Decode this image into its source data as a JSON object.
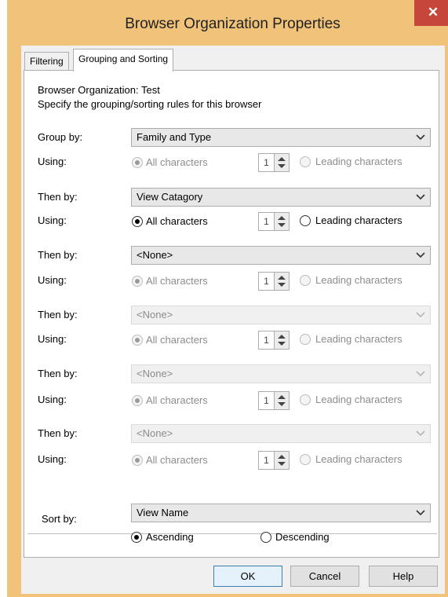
{
  "dialog": {
    "title": "Browser Organization Properties",
    "close_glyph": "✕"
  },
  "tabs": [
    {
      "label": "Filtering",
      "active": false
    },
    {
      "label": "Grouping and Sorting",
      "active": true
    }
  ],
  "header": {
    "org_line": "Browser Organization: Test",
    "desc_line": "Specify the grouping/sorting rules for this browser"
  },
  "labels": {
    "group_by": "Group by:",
    "then_by": "Then by:",
    "using": "Using:",
    "sort_by": "Sort by:",
    "all_chars": "All characters",
    "leading_chars": "Leading characters"
  },
  "rules": [
    {
      "value": "Family and Type",
      "enabled": true,
      "using_enabled": false,
      "count": "1"
    },
    {
      "value": "View Catagory",
      "enabled": true,
      "using_enabled": true,
      "count": "1"
    },
    {
      "value": "<None>",
      "enabled": true,
      "using_enabled": false,
      "count": "1"
    },
    {
      "value": "<None>",
      "enabled": false,
      "using_enabled": false,
      "count": "1"
    },
    {
      "value": "<None>",
      "enabled": false,
      "using_enabled": false,
      "count": "1"
    },
    {
      "value": "<None>",
      "enabled": false,
      "using_enabled": false,
      "count": "1"
    }
  ],
  "sort": {
    "value": "View Name",
    "ascending_label": "Ascending",
    "descending_label": "Descending",
    "order": "ascending"
  },
  "buttons": {
    "ok": "OK",
    "cancel": "Cancel",
    "help": "Help"
  }
}
